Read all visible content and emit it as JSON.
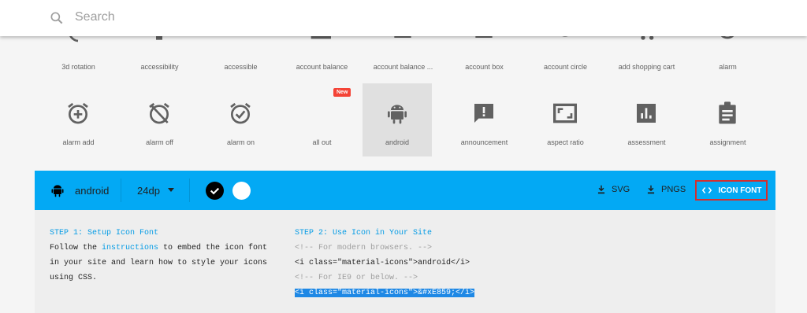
{
  "search": {
    "placeholder": "Search"
  },
  "icons_row1": [
    {
      "label": "3d rotation"
    },
    {
      "label": "accessibility"
    },
    {
      "label": "accessible"
    },
    {
      "label": "account balance"
    },
    {
      "label": "account balance ..."
    },
    {
      "label": "account box"
    },
    {
      "label": "account circle"
    },
    {
      "label": "add shopping cart"
    },
    {
      "label": "alarm"
    }
  ],
  "icons_row2": [
    {
      "label": "alarm add"
    },
    {
      "label": "alarm off"
    },
    {
      "label": "alarm on"
    },
    {
      "label": "all out",
      "badge": "New"
    },
    {
      "label": "android",
      "selected": true
    },
    {
      "label": "announcement"
    },
    {
      "label": "aspect ratio"
    },
    {
      "label": "assessment"
    },
    {
      "label": "assignment"
    }
  ],
  "toolbar": {
    "icon_name": "android",
    "size": "24dp",
    "download_svg": "SVG",
    "download_pngs": "PNGS",
    "icon_font": "ICON FONT",
    "colors": {
      "accent": "#03a9f4",
      "dark_swatch": "#000000",
      "light_swatch": "#ffffff",
      "highlight_border": "#d32f2f"
    }
  },
  "step1": {
    "heading": "STEP 1: Setup Icon Font",
    "line1_pre": "Follow the ",
    "line1_link": "instructions",
    "line1_post": " to embed the icon font",
    "line2": "in your site and learn how to style your icons",
    "line3": "using CSS."
  },
  "step2": {
    "heading": "STEP 2: Use Icon in Your Site",
    "comment1": "<!-- For modern browsers. -->",
    "code1": "<i class=\"material-icons\">android</i>",
    "comment2": "<!-- For IE9 or below. -->",
    "code2": "<i class=\"material-icons\">&#xE859;</i>"
  }
}
